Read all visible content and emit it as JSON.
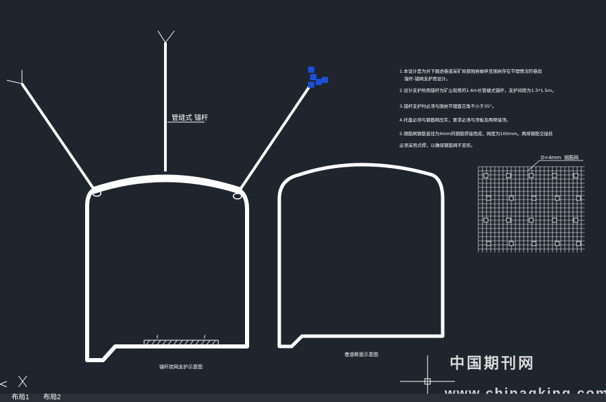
{
  "drawing": {
    "bolt_label": "管缝式 锚杆",
    "notes": [
      "1.本设计是为井下掘进巷道采矿局部围岩破碎且围岩存在节理情况的巷段",
      "锚杆-锚网支护而设计。",
      "2.设计支护所用锚杆为矿山现用的1.6m长管缝式锚杆，支护间距为1.5*1.5m。",
      "3.锚杆支护时必须与围岩节理面交角不小于35°。",
      "4.托盘必须与钢筋网压实，要求必须与顶板及两帮接顶。",
      "5.钢筋网钢筋直径为4mm的钢筋焊接而成，网度为100mm。两排钢筋交接处",
      "必须采用点焊，以确保钢筋网不变形。"
    ],
    "mesh_label_dia": "D=4mm",
    "mesh_label_name": "钢筋网",
    "caption_support": "锚杆挂网支护示意图",
    "caption_section": "巷道断面示意图"
  },
  "tabs": [
    "布局1",
    "布局2"
  ],
  "watermark": {
    "cn": "中国期刊网",
    "url": "www.chinaqking.com"
  },
  "colors": {
    "background": "#1f252d",
    "line": "#ffffff",
    "grip": "#1a4fd6"
  }
}
